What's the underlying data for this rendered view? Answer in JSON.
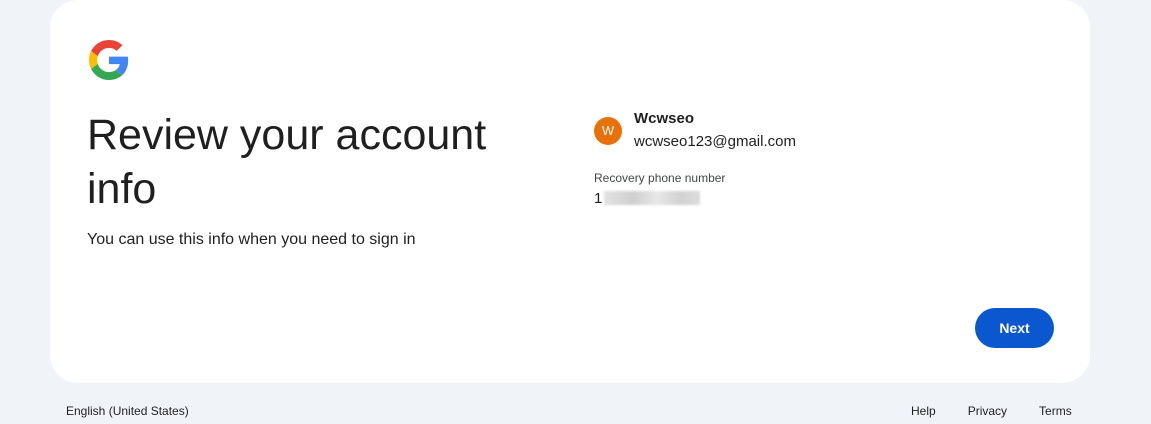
{
  "header": {
    "logo": "google-g-logo"
  },
  "main": {
    "title": "Review your account info",
    "subtitle": "You can use this info when you need to sign in"
  },
  "account": {
    "avatar_initial": "W",
    "avatar_color": "#e8710a",
    "name": "Wcwseo",
    "email": "wcwseo123@gmail.com",
    "recovery_phone_label": "Recovery phone number",
    "recovery_phone_visible": "1"
  },
  "actions": {
    "next_label": "Next",
    "accent_color": "#0b57d0"
  },
  "footer": {
    "language": "English (United States)",
    "links": [
      "Help",
      "Privacy",
      "Terms"
    ]
  }
}
